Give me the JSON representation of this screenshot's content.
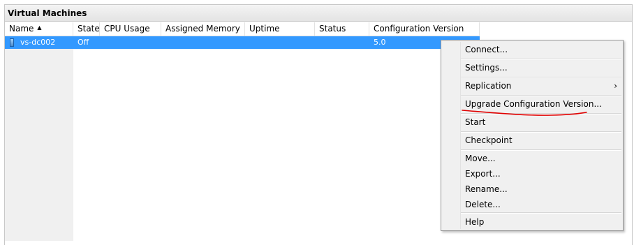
{
  "panel": {
    "title": "Virtual Machines"
  },
  "columns": [
    {
      "label": "Name",
      "sort": "ascending"
    },
    {
      "label": "State"
    },
    {
      "label": "CPU Usage"
    },
    {
      "label": "Assigned Memory"
    },
    {
      "label": "Uptime"
    },
    {
      "label": "Status"
    },
    {
      "label": "Configuration Version"
    }
  ],
  "sort_indicator": "▲",
  "rows": [
    {
      "name": "vs-dc002",
      "state": "Off",
      "cpu_usage": "",
      "assigned_memory": "",
      "uptime": "",
      "status": "",
      "configuration_version": "5.0",
      "selected": true,
      "icon": "vm-icon"
    }
  ],
  "context_menu": {
    "items": [
      {
        "label": "Connect..."
      },
      {
        "label": "Settings..."
      },
      {
        "label": "Replication",
        "submenu_arrow": "›"
      },
      {
        "label": "Upgrade Configuration Version...",
        "annotated": true
      },
      {
        "label": "Start"
      },
      {
        "label": "Checkpoint"
      },
      {
        "label": "Move..."
      },
      {
        "label": "Export..."
      },
      {
        "label": "Rename..."
      },
      {
        "label": "Delete..."
      },
      {
        "label": "Help"
      }
    ]
  },
  "colors": {
    "selection": "#3399ff",
    "annotation_underline": "#e00000",
    "menu_background": "#f0f0f0"
  }
}
